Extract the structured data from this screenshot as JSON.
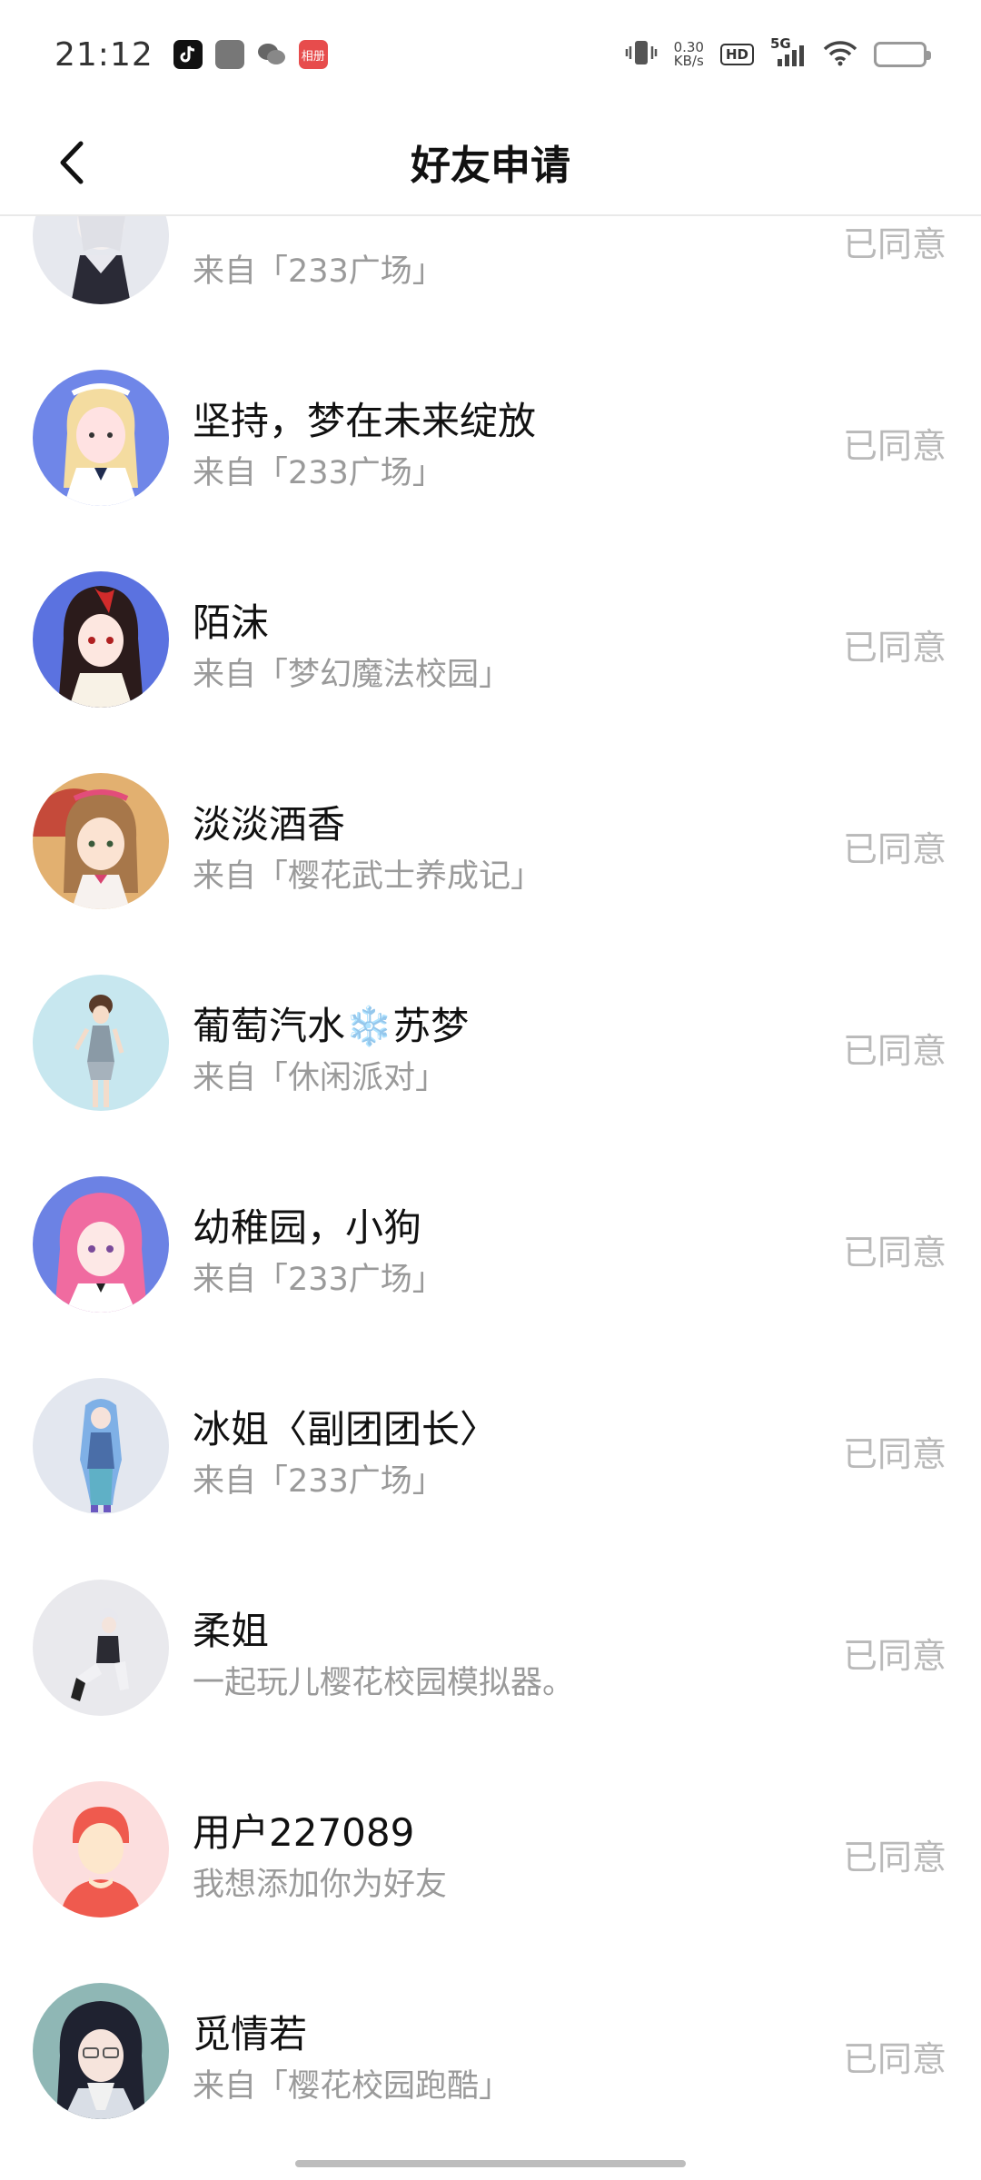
{
  "status_bar": {
    "time": "21:12",
    "app_red_label": "相册",
    "net_speed_value": "0.30",
    "net_speed_unit": "KB/s",
    "hd": "HD",
    "network": "5G",
    "battery_level_pct": 20
  },
  "header": {
    "title": "好友申请",
    "back_icon": "chevron-left-icon"
  },
  "requests": [
    {
      "name": "",
      "subtitle": "来自「233广场」",
      "status": "已同意"
    },
    {
      "name": "坚持，梦在未来绽放",
      "subtitle": "来自「233广场」",
      "status": "已同意"
    },
    {
      "name": "陌沫",
      "subtitle": "来自「梦幻魔法校园」",
      "status": "已同意"
    },
    {
      "name": "淡淡酒香",
      "subtitle": "来自「樱花武士养成记」",
      "status": "已同意"
    },
    {
      "name": "葡萄汽水❄️苏梦",
      "subtitle": "来自「休闲派对」",
      "status": "已同意"
    },
    {
      "name": "幼稚园，小狗",
      "subtitle": "来自「233广场」",
      "status": "已同意"
    },
    {
      "name": "冰姐〈副团团长〉",
      "subtitle": "来自「233广场」",
      "status": "已同意"
    },
    {
      "name": "柔姐",
      "subtitle": "一起玩儿樱花校园模拟器。",
      "status": "已同意"
    },
    {
      "name": "用户227089",
      "subtitle": "我想添加你为好友",
      "status": "已同意"
    },
    {
      "name": "觅情若",
      "subtitle": "来自「樱花校园跑酷」",
      "status": "已同意"
    }
  ]
}
